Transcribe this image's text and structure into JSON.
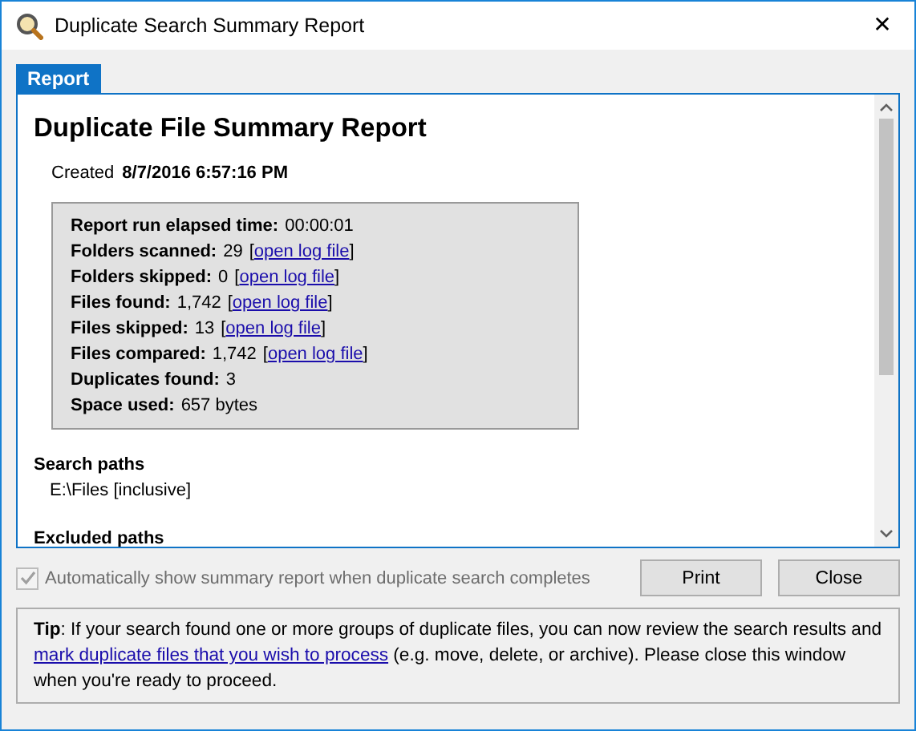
{
  "window": {
    "title": "Duplicate Search Summary Report",
    "close": "✕"
  },
  "tabs": [
    {
      "label": "Report",
      "selected": true
    }
  ],
  "report": {
    "heading": "Duplicate File Summary Report",
    "created_label": "Created",
    "created_value": "8/7/2016 6:57:16 PM",
    "stats": [
      {
        "label": "Report run elapsed time:",
        "value": "00:00:01"
      },
      {
        "label": "Folders scanned:",
        "value": "29",
        "link": {
          "before": "[",
          "text": "open log file",
          "after": "]"
        }
      },
      {
        "label": "Folders skipped:",
        "value": "0",
        "link": {
          "before": "[",
          "text": "open log file",
          "after": "]"
        }
      },
      {
        "label": "Files found:",
        "value": "1,742",
        "link": {
          "before": "[",
          "text": "open log file",
          "after": "]"
        }
      },
      {
        "label": "Files skipped:",
        "value": "13",
        "link": {
          "before": "[",
          "text": "open log file",
          "after": "]"
        }
      },
      {
        "label": "Files compared:",
        "value": "1,742",
        "link": {
          "before": "[",
          "text": "open log file",
          "after": "]"
        }
      },
      {
        "label": "Duplicates found:",
        "value": "3"
      },
      {
        "label": "Space used:",
        "value": "657 bytes"
      }
    ],
    "sections": [
      {
        "heading": "Search paths",
        "items": [
          "E:\\Files [inclusive]"
        ]
      },
      {
        "heading": "Excluded paths"
      }
    ]
  },
  "auto_show": {
    "label": "Automatically show summary report when duplicate search completes",
    "checked": true,
    "disabled": true
  },
  "buttons": [
    "Print",
    "Close"
  ],
  "tip": {
    "before": "**Tip**: If your search found one or more groups of duplicate files, you can now review the search results and ",
    "link": "mark duplicate files that you wish to process",
    "after": " (e.g. move, delete, or archive). Please close this window when you're ready to proceed."
  }
}
